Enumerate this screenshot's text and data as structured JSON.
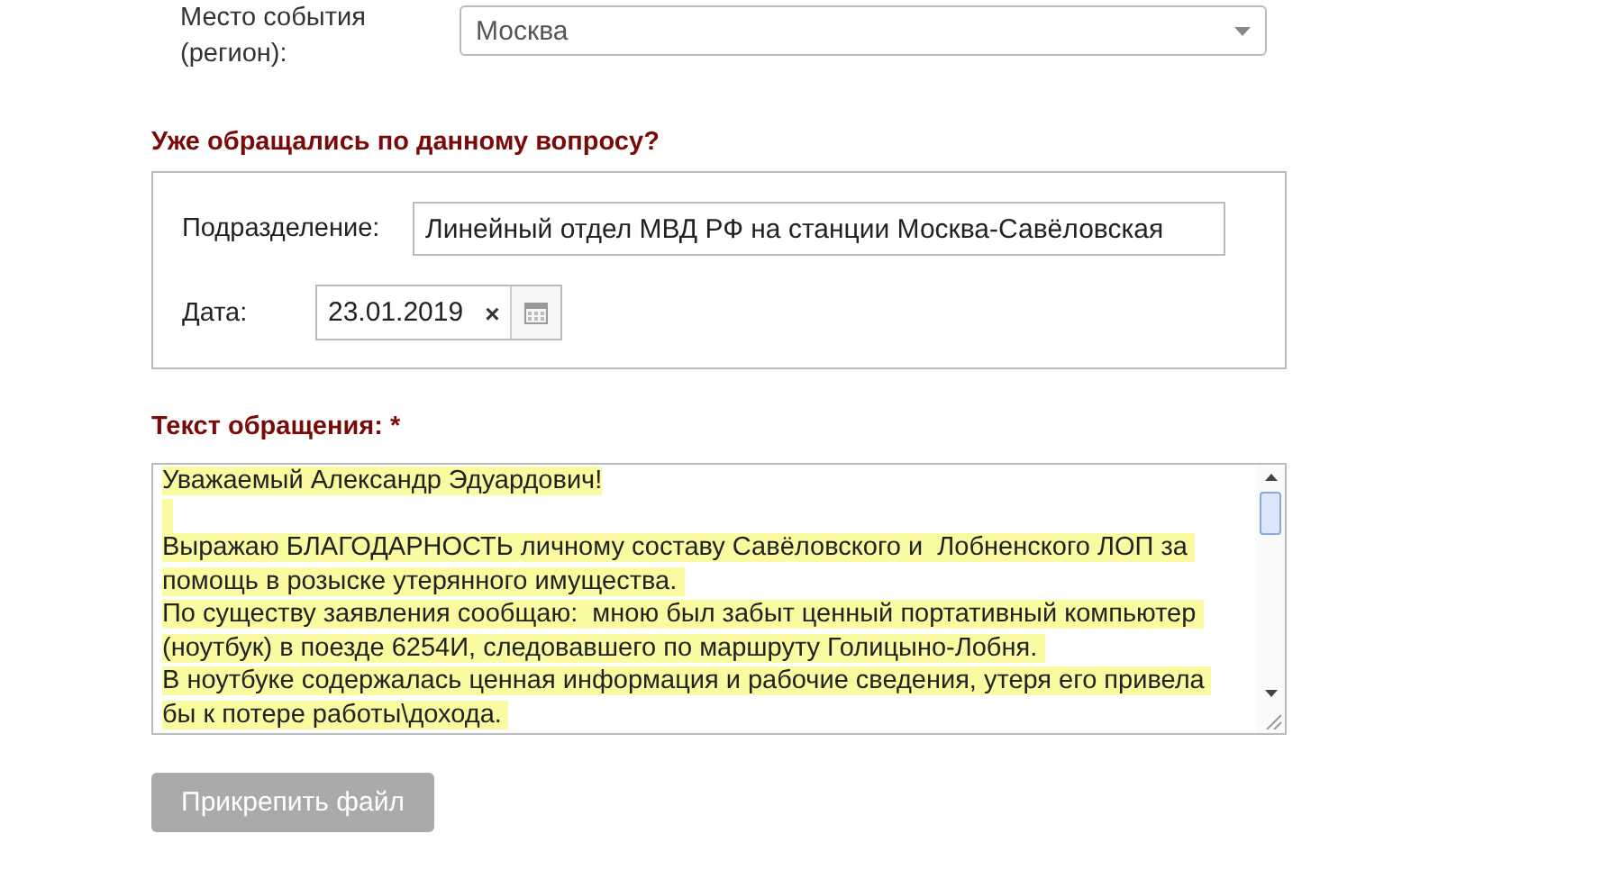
{
  "region": {
    "label": "Место события (регион):",
    "value": "Москва"
  },
  "previous_appeal": {
    "heading": "Уже обращались по данному вопросу?",
    "department": {
      "label": "Подразделение:",
      "value": "Линейный отдел МВД РФ на станции Москва-Савёловская"
    },
    "date": {
      "label": "Дата:",
      "value": "23.01.2019",
      "clear": "×"
    }
  },
  "message": {
    "heading": "Текст обращения: *",
    "lines": [
      {
        "kind": "text",
        "text": "Уважаемый Александр Эдуардович!"
      },
      {
        "kind": "blank"
      },
      {
        "kind": "text",
        "text": "Выражаю БЛАГОДАРНОСТЬ личному составу Савёловского и  Лобненского ЛОП за "
      },
      {
        "kind": "text",
        "text": "помощь в розыске утерянного имущества. "
      },
      {
        "kind": "text",
        "text": "По существу заявления сообщаю:  мною был забыт ценный портативный компьютер "
      },
      {
        "kind": "text",
        "text": "(ноутбук) в поезде 6254И, следовавшего по маршруту Голицыно-Лобня. "
      },
      {
        "kind": "text",
        "text": "В ноутбуке содержалась ценная информация и рабочие сведения, утеря его привела "
      },
      {
        "kind": "text",
        "text": "бы к потере работы\\дохода. "
      }
    ]
  },
  "attach_button": {
    "label": "Прикрепить файл",
    "disabled": true
  }
}
